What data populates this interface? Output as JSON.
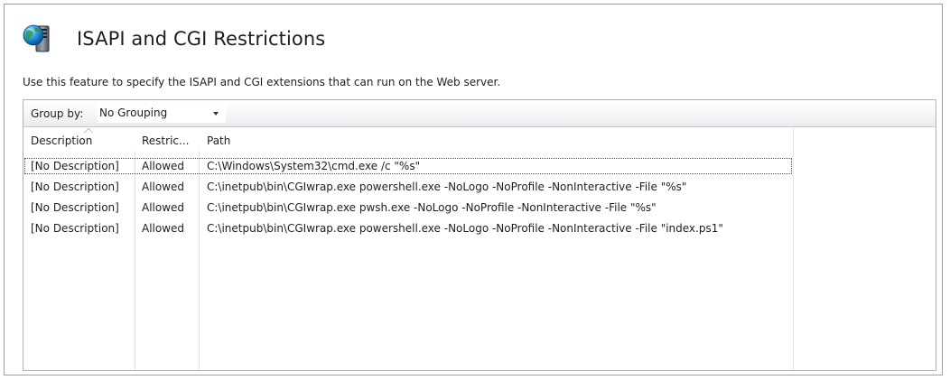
{
  "header": {
    "title": "ISAPI and CGI Restrictions",
    "icon": "globe-server-icon",
    "description": "Use this feature to specify the ISAPI and CGI extensions that can run on the Web server."
  },
  "toolbar": {
    "groupby_label": "Group by:",
    "groupby_value": "No Grouping",
    "groupby_icon": "chevron-down-icon"
  },
  "table": {
    "columns": [
      "Description",
      "Restric...",
      "Path"
    ],
    "sorted_column": "Description",
    "rows": [
      {
        "description": "[No Description]",
        "restriction": "Allowed",
        "path": "C:\\Windows\\System32\\cmd.exe /c \"%s\"",
        "selected": true
      },
      {
        "description": "[No Description]",
        "restriction": "Allowed",
        "path": "C:\\inetpub\\bin\\CGIwrap.exe powershell.exe -NoLogo -NoProfile -NonInteractive -File \"%s\"",
        "selected": false
      },
      {
        "description": "[No Description]",
        "restriction": "Allowed",
        "path": "C:\\inetpub\\bin\\CGIwrap.exe pwsh.exe -NoLogo -NoProfile -NonInteractive -File \"%s\"",
        "selected": false
      },
      {
        "description": "[No Description]",
        "restriction": "Allowed",
        "path": "C:\\inetpub\\bin\\CGIwrap.exe powershell.exe -NoLogo -NoProfile -NonInteractive -File \"index.ps1\"",
        "selected": false
      }
    ]
  },
  "colors": {
    "border": "#a0a0a0",
    "grid_line": "#e4e4e4",
    "selection_outline": "#555555"
  }
}
